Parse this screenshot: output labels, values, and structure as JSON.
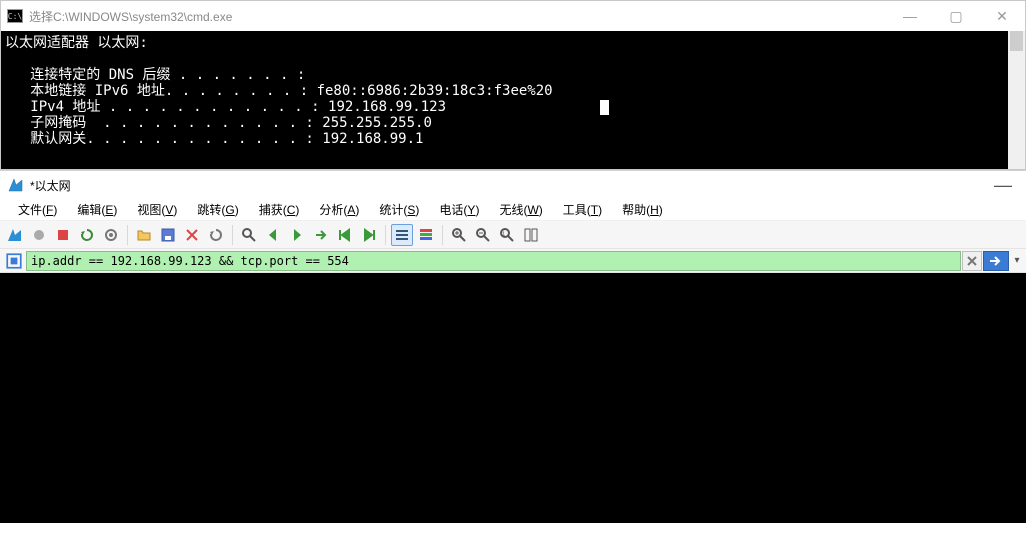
{
  "cmd": {
    "title": "选择C:\\WINDOWS\\system32\\cmd.exe",
    "icon_label": "C:\\",
    "lines": {
      "header": "以太网适配器 以太网:",
      "dns_label": "   连接特定的 DNS 后缀 . . . . . . . :",
      "ipv6_label": "   本地链接 IPv6 地址. . . . . . . . : ",
      "ipv6_value": "fe80::6986:2b39:18c3:f3ee%20",
      "ipv4_label": "   IPv4 地址 . . . . . . . . . . . . : ",
      "ipv4_value": "192.168.99.123",
      "mask_label": "   子网掩码  . . . . . . . . . . . . : ",
      "mask_value": "255.255.255.0",
      "gw_label": "   默认网关. . . . . . . . . . . . . : ",
      "gw_value": "192.168.99.1"
    },
    "controls": {
      "min": "—",
      "max": "▢",
      "close": "✕"
    }
  },
  "ws": {
    "title": "*以太网",
    "controls": {
      "min": "—"
    },
    "menu": [
      {
        "label": "文件",
        "key": "F"
      },
      {
        "label": "编辑",
        "key": "E"
      },
      {
        "label": "视图",
        "key": "V"
      },
      {
        "label": "跳转",
        "key": "G"
      },
      {
        "label": "捕获",
        "key": "C"
      },
      {
        "label": "分析",
        "key": "A"
      },
      {
        "label": "统计",
        "key": "S"
      },
      {
        "label": "电话",
        "key": "Y"
      },
      {
        "label": "无线",
        "key": "W"
      },
      {
        "label": "工具",
        "key": "T"
      },
      {
        "label": "帮助",
        "key": "H"
      }
    ],
    "filter": {
      "value": "ip.addr == 192.168.99.123 && tcp.port == 554"
    },
    "toolbar_names": [
      "fin-icon",
      "folder-icon",
      "save-icon",
      "close-file-icon",
      "reload-icon",
      "find-icon",
      "back-icon",
      "forward-icon",
      "jump-icon",
      "goto-last-icon",
      "auto-scroll-icon",
      "colorize-icon",
      "zoom-in-icon",
      "zoom-out-icon",
      "zoom-reset-icon",
      "resize-cols-icon"
    ]
  }
}
